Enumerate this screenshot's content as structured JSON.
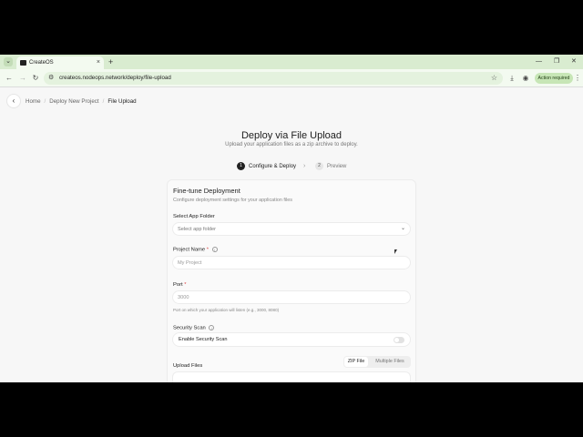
{
  "browser": {
    "tab_title": "CreateOS",
    "url": "createos.nodeops.network/deploy/file-upload",
    "action_required": "Action required"
  },
  "breadcrumb": {
    "items": [
      "Home",
      "Deploy New Project",
      "File Upload"
    ]
  },
  "header": {
    "title": "Deploy via File Upload",
    "subtitle": "Upload your application files as a zip archive to deploy."
  },
  "steps": [
    {
      "num": "1",
      "label": "Configure & Deploy",
      "active": true
    },
    {
      "num": "2",
      "label": "Preview",
      "active": false
    }
  ],
  "card": {
    "title": "Fine-tune Deployment",
    "subtitle": "Configure deployment settings for your application files",
    "app_folder": {
      "label": "Select App Folder",
      "placeholder": "Select app folder"
    },
    "project_name": {
      "label": "Project Name",
      "required": "*",
      "placeholder": "My Project"
    },
    "port": {
      "label": "Port",
      "required": "*",
      "placeholder": "3000",
      "help": "Port on which your application will listen (e.g., 3000, 8080)"
    },
    "security_scan": {
      "label": "Security Scan",
      "toggle_label": "Enable Security Scan",
      "enabled": false
    },
    "upload": {
      "label": "Upload Files",
      "tabs": [
        "ZIP File",
        "Multiple Files"
      ],
      "active_tab": "ZIP File"
    }
  },
  "icons": {
    "back": "chevron-left-icon",
    "info": "info-icon",
    "dropdown": "chevron-down-icon"
  }
}
